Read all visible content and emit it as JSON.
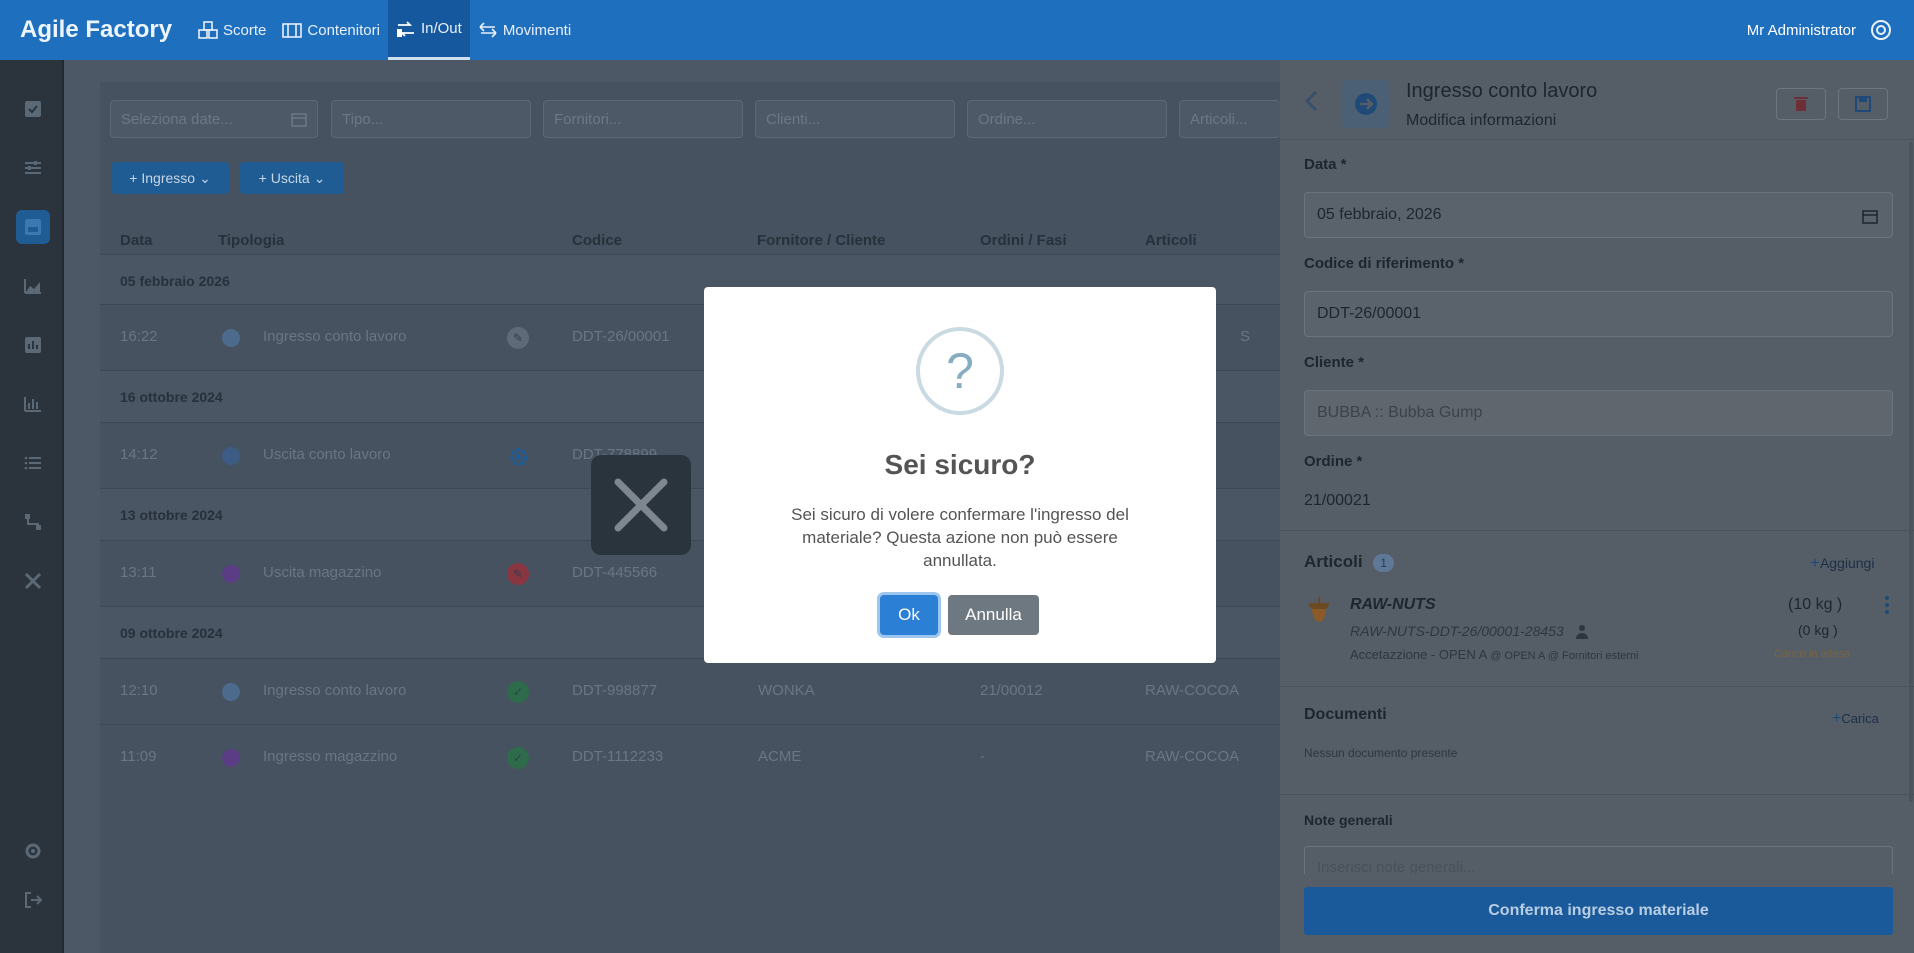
{
  "app": {
    "brand": "Agile Factory",
    "user": "Mr Administrator"
  },
  "nav": [
    {
      "label": "Scorte",
      "icon": "boxes-icon"
    },
    {
      "label": "Contenitori",
      "icon": "container-icon"
    },
    {
      "label": "In/Out",
      "icon": "in-out-icon",
      "active": true
    },
    {
      "label": "Movimenti",
      "icon": "arrows-icon"
    }
  ],
  "filters": {
    "date": "Seleziona date...",
    "type": "Tipo...",
    "suppliers": "Fornitori...",
    "clients": "Clienti...",
    "order": "Ordine...",
    "articles": "Articoli..."
  },
  "actions": {
    "ingresso": "Ingresso",
    "uscita": "Uscita"
  },
  "table": {
    "headers": [
      "Data",
      "Tipologia",
      "Codice",
      "Fornitore / Cliente",
      "Ordini / Fasi",
      "Articoli"
    ],
    "groups": [
      {
        "date": "05 febbraio 2026",
        "rows": [
          {
            "time": "16:22",
            "type": "Ingresso conto lavoro",
            "code": "DDT-26/00001",
            "party": "",
            "order": "",
            "article": "S",
            "status": "edit"
          }
        ]
      },
      {
        "date": "16 ottobre 2024",
        "rows": [
          {
            "time": "14:12",
            "type": "Uscita conto lavoro",
            "code": "DDT-778899",
            "party": "",
            "order": "",
            "article": "",
            "status": "gear"
          }
        ]
      },
      {
        "date": "13 ottobre 2024",
        "rows": [
          {
            "time": "13:11",
            "type": "Uscita magazzino",
            "code": "DDT-445566",
            "party": "",
            "order": "",
            "article": "",
            "status": "edit-red"
          }
        ]
      },
      {
        "date": "09 ottobre 2024",
        "rows": [
          {
            "time": "12:10",
            "type": "Ingresso conto lavoro",
            "code": "DDT-998877",
            "party": "WONKA",
            "order": "21/00012",
            "article": "RAW-COCOA",
            "status": "check"
          },
          {
            "time": "11:09",
            "type": "Ingresso magazzino",
            "code": "DDT-1112233",
            "party": "ACME",
            "order": "-",
            "article": "RAW-COCOA",
            "status": "check"
          }
        ]
      }
    ]
  },
  "panel": {
    "title": "Ingresso conto lavoro",
    "subtitle": "Modifica informazioni",
    "date_label": "Data *",
    "date_value": "05 febbraio, 2026",
    "ref_label": "Codice di riferimento *",
    "ref_value": "DDT-26/00001",
    "client_label": "Cliente *",
    "client_value": "BUBBA :: Bubba Gump",
    "order_label": "Ordine *",
    "order_value": "21/00021",
    "articles_label": "Articoli",
    "articles_count": "1",
    "add_label": "Aggiungi",
    "article": {
      "name": "RAW-NUTS",
      "lot": "RAW-NUTS-DDT-26/00001-28453",
      "qty": "(10 kg )",
      "qty2": "(0 kg )",
      "acceptance": "Accetazzione - OPEN A",
      "location": "@ OPEN A @ Fornitori esterni",
      "status": "Carico in attesa"
    },
    "docs_label": "Documenti",
    "upload_label": "Carica",
    "no_docs": "Nessun documento presente",
    "notes_label": "Note generali",
    "notes_placeholder": "Inserisci note generali...",
    "confirm": "Conferma ingresso materiale"
  },
  "modal": {
    "icon": "?",
    "title": "Sei sicuro?",
    "text": "Sei sicuro di volere confermare l'ingresso del materiale? Questa azione non può essere annullata.",
    "ok": "Ok",
    "cancel": "Annulla"
  },
  "colors": {
    "primary": "#1f6fbf",
    "ok_button": "#2b7fd4",
    "cancel_button": "#6e7881",
    "pending": "#e6a23c"
  }
}
